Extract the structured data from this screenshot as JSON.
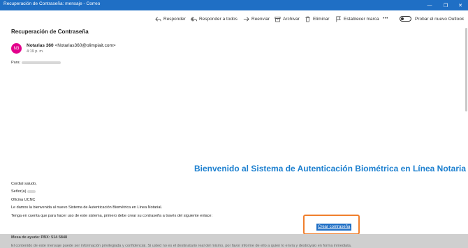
{
  "window": {
    "title": "Recuperación de Contraseña: mensaje - Correo",
    "min_glyph": "—",
    "max_glyph": "❐",
    "close_glyph": "✕",
    "titlebar_color": "#1f6fc5"
  },
  "toolbar": {
    "reply": "Responder",
    "reply_all": "Responder a todos",
    "forward": "Reenviar",
    "archive": "Archivar",
    "delete": "Eliminar",
    "flag": "Establecer marca",
    "more": "•••",
    "toggle_label": "Probar el nuevo Outlook"
  },
  "message": {
    "subject": "Recuperación de Contraseña",
    "avatar_initials": "N3",
    "avatar_color": "#e3008c",
    "sender_name": "Notarias 360",
    "sender_email": "<Notarias360@olimpiait.com>",
    "time": "4:19 p. m.",
    "to_label": "Para:"
  },
  "body": {
    "welcome": "Bienvenido al Sistema de Autenticación Biométrica en Línea Notaria",
    "greeting": "Cordial saludo,",
    "recipient_label": "Señor(a)",
    "office": "Oficina UCNC",
    "intro": "Le damos la bienvenida al nuevo Sistema de Autenticación Biométrica en Línea Notarial.",
    "instructions": "Tenga en cuenta que para hacer uso de este sistema, primero debe crear su contraseña a través del siguiente enlace:",
    "cta_label": "Crear contraseña",
    "accent_color": "#1b7fcf",
    "highlight_color": "#f07f2d"
  },
  "footer": {
    "help_desk": "Mesa de ayuda: PBX: 514 5848",
    "note": "El contenido de este mensaje puede ser información privilegiada y confidencial. Si usted no es el destinatario real del mismo, por favor informe de ello a quien lo envía y destrúyalo en forma inmediata."
  }
}
